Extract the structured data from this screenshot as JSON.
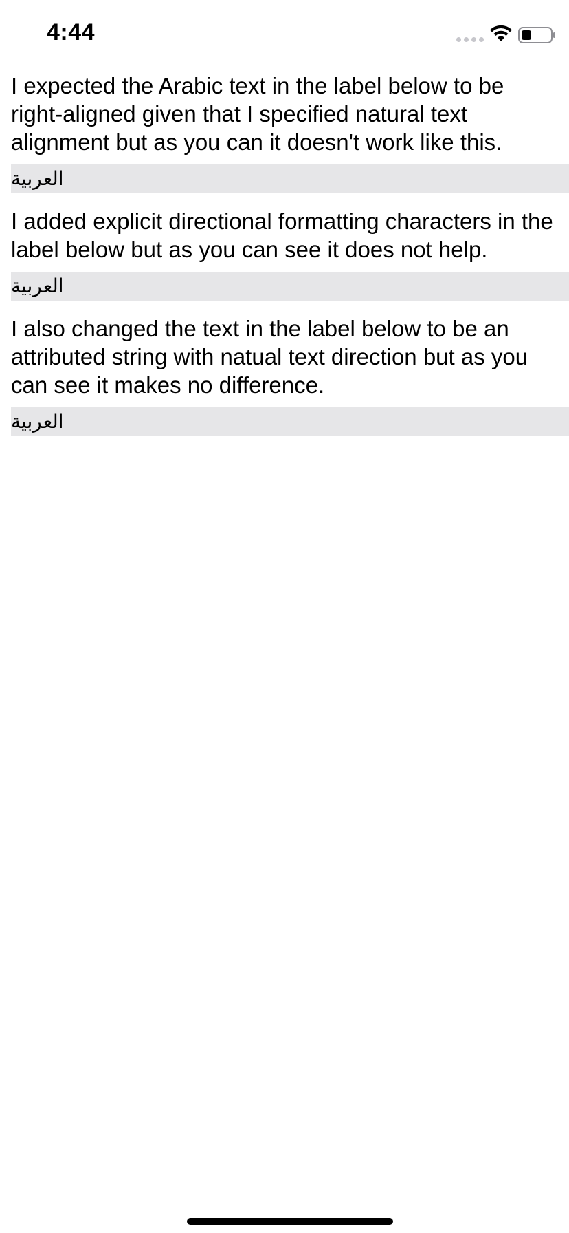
{
  "status_bar": {
    "time": "4:44",
    "icons": [
      "signal-dots-icon",
      "wifi-icon",
      "battery-icon"
    ]
  },
  "content": {
    "blocks": [
      {
        "paragraph": "I expected the Arabic text in the label below to be right-aligned given that I specified natural text alignment but as you can it doesn't work like this.",
        "label": "العربية"
      },
      {
        "paragraph": "I added explicit directional formatting characters in the label below but as you can see it does not help.",
        "label": "العربية"
      },
      {
        "paragraph": "I also changed the text in the label below to be an attributed string with natual text direction but as you can see it makes no difference.",
        "label": "العربية"
      }
    ]
  },
  "colors": {
    "background": "#ffffff",
    "label_background": "#e6e6e8",
    "text": "#000000",
    "signal_inactive": "#c7c7cc"
  }
}
